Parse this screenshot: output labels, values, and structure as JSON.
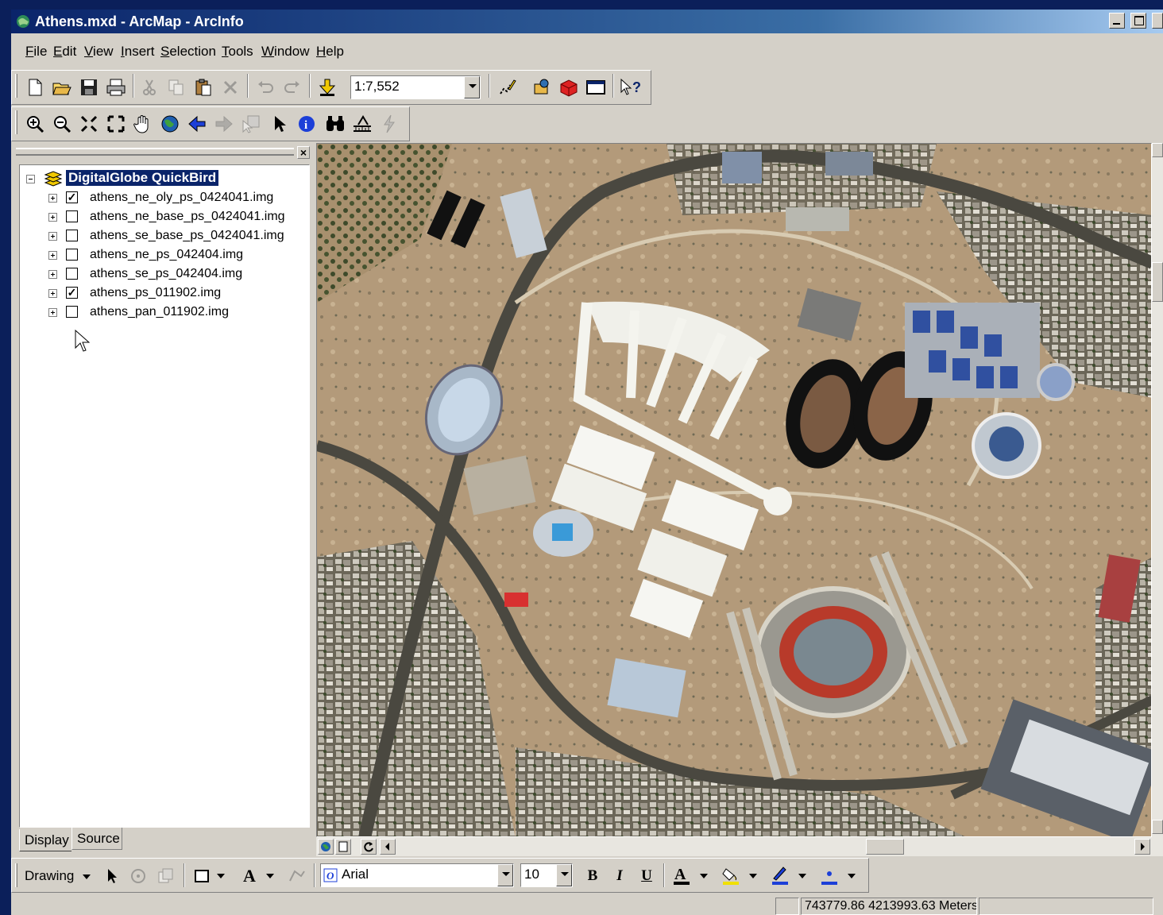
{
  "window": {
    "title": "Athens.mxd - ArcMap - ArcInfo",
    "buttons": [
      "minimize",
      "maximize",
      "close"
    ]
  },
  "menu": {
    "items": [
      {
        "label": "File",
        "key": "F"
      },
      {
        "label": "Edit",
        "key": "E"
      },
      {
        "label": "View",
        "key": "V"
      },
      {
        "label": "Insert",
        "key": "I"
      },
      {
        "label": "Selection",
        "key": "S"
      },
      {
        "label": "Tools",
        "key": "T"
      },
      {
        "label": "Window",
        "key": "W"
      },
      {
        "label": "Help",
        "key": "H"
      }
    ]
  },
  "standard_toolbar": {
    "scale": "1:7,552",
    "icons": [
      "new-document-icon",
      "open-folder-icon",
      "save-icon",
      "print-icon",
      "cut-icon",
      "copy-icon",
      "paste-icon",
      "delete-icon",
      "undo-icon",
      "redo-icon",
      "add-data-icon",
      "editor-icon",
      "arctoolbox-icon",
      "arccatalog-icon",
      "command-line-icon",
      "whats-this-icon"
    ]
  },
  "tools_toolbar": {
    "icons": [
      "zoom-in-icon",
      "zoom-out-icon",
      "fixed-zoom-in-icon",
      "fixed-zoom-out-icon",
      "pan-hand-icon",
      "full-extent-globe-icon",
      "back-arrow-icon",
      "forward-arrow-icon",
      "select-features-icon",
      "select-elements-icon",
      "identify-icon",
      "find-binoculars-icon",
      "measure-icon",
      "hyperlink-icon"
    ]
  },
  "toc": {
    "group": "DigitalGlobe QuickBird",
    "layers": [
      {
        "name": "athens_ne_oly_ps_0424041.img",
        "checked": true
      },
      {
        "name": "athens_ne_base_ps_0424041.img",
        "checked": false
      },
      {
        "name": "athens_se_base_ps_0424041.img",
        "checked": false
      },
      {
        "name": "athens_ne_ps_042404.img",
        "checked": false
      },
      {
        "name": "athens_se_ps_042404.img",
        "checked": false
      },
      {
        "name": "athens_ps_011902.img",
        "checked": true
      },
      {
        "name": "athens_pan_011902.img",
        "checked": false
      }
    ],
    "tabs": {
      "display": "Display",
      "source": "Source"
    }
  },
  "drawing_toolbar": {
    "label": "Drawing",
    "font": "Arial",
    "size": "10",
    "bold": "B",
    "italic": "I",
    "underline": "U",
    "text_tool": "A"
  },
  "status": {
    "coordinates": "743779.86  4213993.63 Meters"
  },
  "colors": {
    "title_start": "#0a246a",
    "title_end": "#a6caf0",
    "chrome": "#d4d0c8",
    "selection": "#0a246a"
  }
}
